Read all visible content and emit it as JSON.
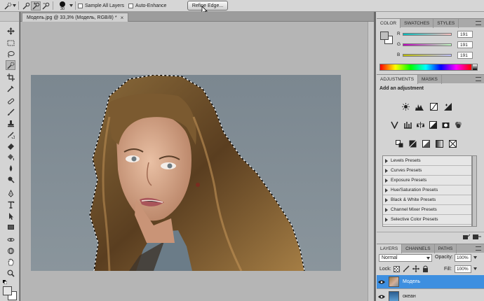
{
  "options_bar": {
    "brush_size": "30",
    "sample_all_layers": "Sample All Layers",
    "auto_enhance": "Auto-Enhance",
    "refine_edge": "Refine Edge..."
  },
  "document": {
    "tab_title": "Модель.jpg @ 33,3% (Модель, RGB/8) *",
    "close_glyph": "×"
  },
  "color_panel": {
    "tabs": [
      "COLOR",
      "SWATCHES",
      "STYLES"
    ],
    "channels": [
      {
        "label": "R",
        "value": "191"
      },
      {
        "label": "G",
        "value": "191"
      },
      {
        "label": "B",
        "value": "191"
      }
    ]
  },
  "adjustments_panel": {
    "tabs": [
      "ADJUSTMENTS",
      "MASKS"
    ],
    "heading": "Add an adjustment",
    "presets": [
      "Levels Presets",
      "Curves Presets",
      "Exposure Presets",
      "Hue/Saturation Presets",
      "Black & White Presets",
      "Channel Mixer Presets",
      "Selective Color Presets"
    ]
  },
  "layers_panel": {
    "tabs": [
      "LAYERS",
      "CHANNELS",
      "PATHS"
    ],
    "blend_mode": "Normal",
    "opacity_label": "Opacity:",
    "opacity_value": "100%",
    "lock_label": "Lock:",
    "fill_label": "Fill:",
    "fill_value": "100%",
    "layers": [
      {
        "name": "Модель",
        "selected": true
      },
      {
        "name": "океан",
        "selected": false
      }
    ]
  },
  "colors": {
    "selection_blue": "#3d8fe0",
    "panel_bg": "#d3d3d3",
    "canvas_bg": "#7f8b93"
  }
}
